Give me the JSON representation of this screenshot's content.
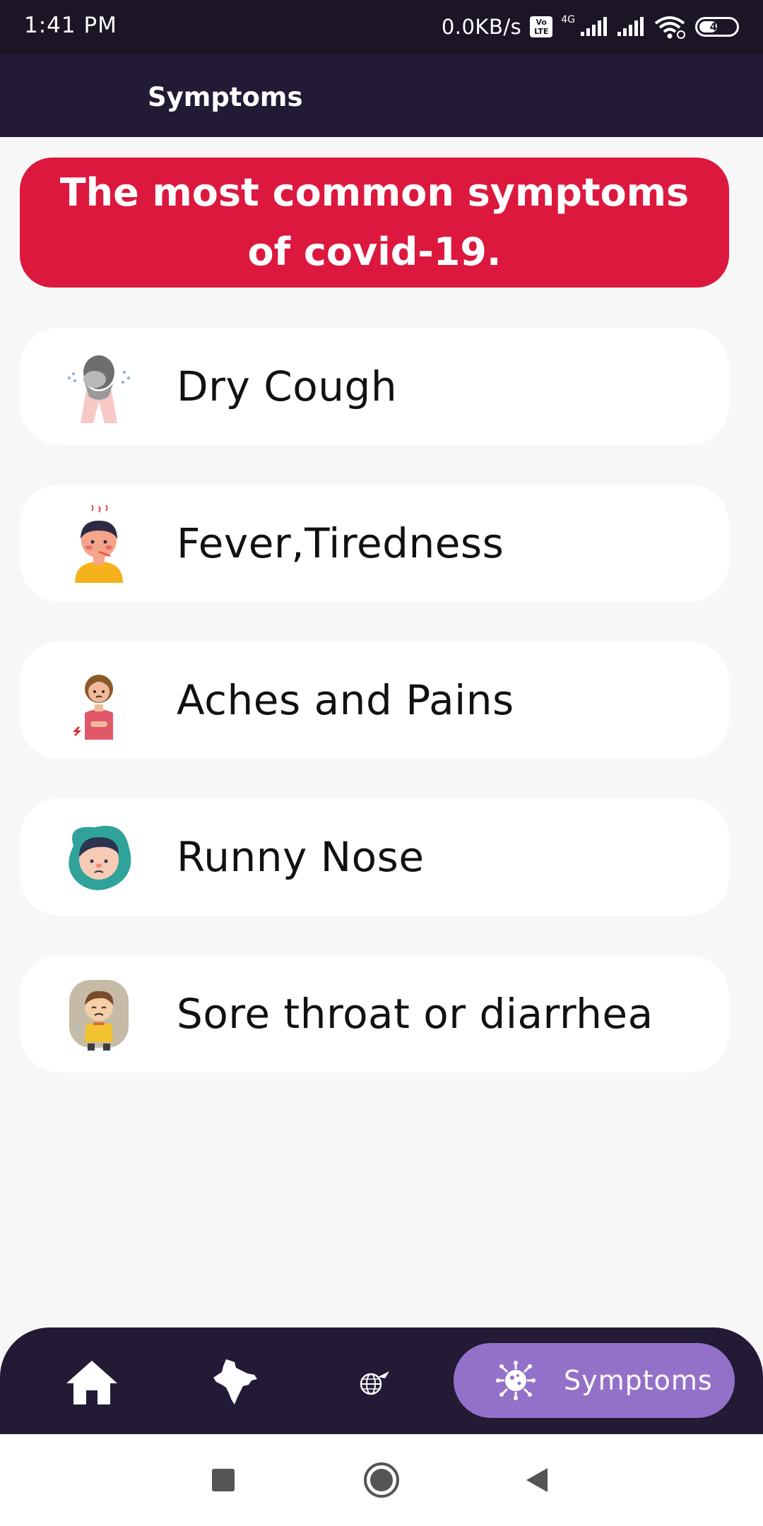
{
  "status_bar": {
    "time": "1:41 PM",
    "net_speed": "0.0KB/s",
    "volte_top": "Vo",
    "volte_bottom": "LTE",
    "network_type": "4G",
    "battery_level": "49",
    "icons": [
      "volte-icon",
      "signal-icon",
      "signal-icon",
      "wifi-icon",
      "battery-icon"
    ]
  },
  "app_bar": {
    "title": "Symptoms"
  },
  "banner": {
    "text": "The most common symptoms of covid-19.",
    "color": "#dc183e"
  },
  "symptoms": [
    {
      "label": "Dry Cough",
      "icon": "coughing-person-icon"
    },
    {
      "label": "Fever,Tiredness",
      "icon": "fever-boy-icon"
    },
    {
      "label": "Aches and Pains",
      "icon": "stomach-ache-girl-icon"
    },
    {
      "label": "Runny Nose",
      "icon": "sick-face-icon"
    },
    {
      "label": "Sore throat or diarrhea",
      "icon": "sore-throat-boy-icon"
    }
  ],
  "bottom_nav": {
    "items": [
      {
        "icon": "home-icon"
      },
      {
        "icon": "india-map-icon"
      },
      {
        "icon": "globe-plane-icon"
      },
      {
        "icon": "virus-icon",
        "label": "Symptoms",
        "selected": true
      }
    ],
    "background": "#231a36",
    "active_color": "#9471c8"
  },
  "system_nav": {
    "icons": [
      "recent-apps-icon",
      "home-circle-icon",
      "back-triangle-icon"
    ]
  }
}
